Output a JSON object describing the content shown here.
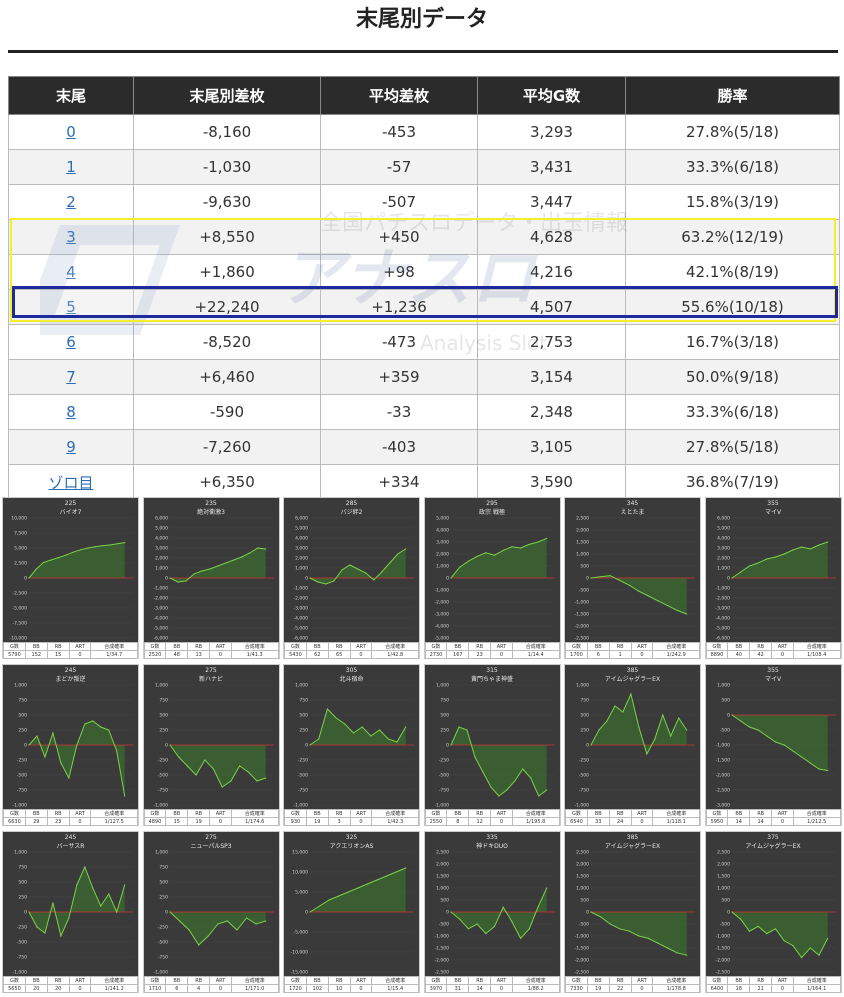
{
  "page": {
    "title": "末尾別データ"
  },
  "table": {
    "headers": [
      "末尾",
      "末尾別差枚",
      "平均差枚",
      "平均G数",
      "勝率"
    ],
    "rows": [
      {
        "tail": "0",
        "diff": "-8,160",
        "avg_diff": "-453",
        "avg_games": "3,293",
        "win_rate": "27.8%(5/18)"
      },
      {
        "tail": "1",
        "diff": "-1,030",
        "avg_diff": "-57",
        "avg_games": "3,431",
        "win_rate": "33.3%(6/18)"
      },
      {
        "tail": "2",
        "diff": "-9,630",
        "avg_diff": "-507",
        "avg_games": "3,447",
        "win_rate": "15.8%(3/19)"
      },
      {
        "tail": "3",
        "diff": "+8,550",
        "avg_diff": "+450",
        "avg_games": "4,628",
        "win_rate": "63.2%(12/19)"
      },
      {
        "tail": "4",
        "diff": "+1,860",
        "avg_diff": "+98",
        "avg_games": "4,216",
        "win_rate": "42.1%(8/19)"
      },
      {
        "tail": "5",
        "diff": "+22,240",
        "avg_diff": "+1,236",
        "avg_games": "4,507",
        "win_rate": "55.6%(10/18)"
      },
      {
        "tail": "6",
        "diff": "-8,520",
        "avg_diff": "-473",
        "avg_games": "2,753",
        "win_rate": "16.7%(3/18)"
      },
      {
        "tail": "7",
        "diff": "+6,460",
        "avg_diff": "+359",
        "avg_games": "3,154",
        "win_rate": "50.0%(9/18)"
      },
      {
        "tail": "8",
        "diff": "-590",
        "avg_diff": "-33",
        "avg_games": "2,348",
        "win_rate": "33.3%(6/18)"
      },
      {
        "tail": "9",
        "diff": "-7,260",
        "avg_diff": "-403",
        "avg_games": "3,105",
        "win_rate": "27.8%(5/18)"
      },
      {
        "tail": "ゾロ目",
        "diff": "+6,350",
        "avg_diff": "+334",
        "avg_games": "3,590",
        "win_rate": "36.8%(7/19)"
      }
    ]
  },
  "watermark": {
    "line1": "全国パチスロデータ・出玉情報",
    "brand": "アナスロ",
    "line2": "Analysis Slot"
  },
  "colors": {
    "highlight_yellow": "#f3ef2a",
    "highlight_blue": "#1d2a99",
    "header_bg": "#2b2b2b",
    "link": "#2c6db3",
    "panel_bg": "#3a3a3a",
    "line": "#7bd14a",
    "zero_line": "#d03030"
  },
  "panel_footer_labels": [
    "G数",
    "BB",
    "RB",
    "ART",
    "合成確率"
  ],
  "machines": [
    {
      "num": "225",
      "name": "バイオ7",
      "yticks": [
        "10,000",
        "7,500",
        "5,000",
        "2,500",
        "0",
        "-2,500",
        "-5,000",
        "-7,500",
        "-10,000"
      ],
      "ymin": -10000,
      "ymax": 10000,
      "series": [
        0,
        1500,
        2600,
        3000,
        3400,
        3800,
        4300,
        4700,
        5000,
        5200,
        5400,
        5500,
        5700,
        5900
      ],
      "stats": [
        "5790",
        "152",
        "15",
        "0",
        "1/34.7"
      ]
    },
    {
      "num": "235",
      "name": "絶対衝激3",
      "yticks": [
        "6,000",
        "5,000",
        "4,000",
        "3,000",
        "2,000",
        "1,000",
        "0",
        "-1,000",
        "-2,000",
        "-3,000",
        "-4,000",
        "-5,000",
        "-6,000"
      ],
      "ymin": -6000,
      "ymax": 6000,
      "series": [
        0,
        -400,
        -300,
        400,
        700,
        900,
        1200,
        1500,
        1800,
        2100,
        2500,
        3000,
        2900
      ],
      "stats": [
        "2520",
        "48",
        "13",
        "0",
        "1/41.3"
      ]
    },
    {
      "num": "285",
      "name": "バジ絆2",
      "yticks": [
        "6,000",
        "5,000",
        "4,000",
        "3,000",
        "2,000",
        "1,000",
        "0",
        "-1,000",
        "-2,000",
        "-3,000",
        "-4,000",
        "-5,000",
        "-6,000"
      ],
      "ymin": -6000,
      "ymax": 6000,
      "series": [
        0,
        -400,
        -600,
        -300,
        800,
        1300,
        900,
        500,
        -200,
        600,
        1500,
        2400,
        2900
      ],
      "stats": [
        "5430",
        "62",
        "65",
        "0",
        "1/42.8"
      ]
    },
    {
      "num": "295",
      "name": "政宗 戦極",
      "yticks": [
        "5,000",
        "4,000",
        "3,000",
        "2,000",
        "1,000",
        "0",
        "-1,000",
        "-2,000",
        "-3,000",
        "-4,000",
        "-5,000"
      ],
      "ymin": -5000,
      "ymax": 5000,
      "series": [
        0,
        900,
        1400,
        1800,
        2100,
        1900,
        2300,
        2600,
        2500,
        2800,
        3000,
        3300
      ],
      "stats": [
        "2730",
        "167",
        "23",
        "0",
        "1/14.4"
      ]
    },
    {
      "num": "345",
      "name": "えとたま",
      "yticks": [
        "2,500",
        "2,000",
        "1,500",
        "1,000",
        "500",
        "0",
        "-500",
        "-1,000",
        "-1,500",
        "-2,000",
        "-2,500"
      ],
      "ymin": -2500,
      "ymax": 2500,
      "series": [
        0,
        50,
        100,
        -100,
        -300,
        -550,
        -750,
        -950,
        -1150,
        -1350,
        -1500
      ],
      "stats": [
        "1700",
        "6",
        "1",
        "0",
        "1/242.9"
      ]
    },
    {
      "num": "355",
      "name": "マイV",
      "yticks": [
        "6,000",
        "5,000",
        "4,000",
        "3,000",
        "2,000",
        "1,000",
        "0",
        "-1,000",
        "-2,000",
        "-3,000",
        "-4,000",
        "-5,000",
        "-6,000"
      ],
      "ymin": -6000,
      "ymax": 6000,
      "series": [
        0,
        600,
        1200,
        1500,
        1900,
        2100,
        2400,
        2800,
        3100,
        2900,
        3300,
        3600
      ],
      "stats": [
        "8890",
        "40",
        "42",
        "0",
        "1/108.4"
      ]
    },
    {
      "num": "245",
      "name": "まどか叛逆",
      "yticks": [
        "1,000",
        "750",
        "500",
        "250",
        "0",
        "-250",
        "-500",
        "-750",
        "-1,000"
      ],
      "ymin": -1000,
      "ymax": 1000,
      "series": [
        0,
        150,
        -200,
        200,
        -300,
        -550,
        0,
        350,
        400,
        300,
        250,
        -100,
        -850
      ],
      "stats": [
        "6630",
        "29",
        "23",
        "0",
        "1/127.5"
      ]
    },
    {
      "num": "275",
      "name": "新ハナビ",
      "yticks": [
        "1,000",
        "750",
        "500",
        "250",
        "0",
        "-250",
        "-500",
        "-750",
        "-1,000"
      ],
      "ymin": -1000,
      "ymax": 1000,
      "series": [
        0,
        -200,
        -350,
        -500,
        -250,
        -400,
        -700,
        -600,
        -350,
        -450,
        -600,
        -550
      ],
      "stats": [
        "4890",
        "15",
        "19",
        "0",
        "1/174.6"
      ]
    },
    {
      "num": "305",
      "name": "北斗宿命",
      "yticks": [
        "1,000",
        "750",
        "500",
        "250",
        "0",
        "-250",
        "-500",
        "-750",
        "-1,000"
      ],
      "ymin": -1000,
      "ymax": 1000,
      "series": [
        0,
        100,
        600,
        450,
        350,
        200,
        300,
        150,
        250,
        100,
        50,
        300
      ],
      "stats": [
        "930",
        "19",
        "3",
        "0",
        "1/42.3"
      ]
    },
    {
      "num": "315",
      "name": "黄門ちゃま神盛",
      "yticks": [
        "1,000",
        "750",
        "500",
        "250",
        "0",
        "-250",
        "-500",
        "-750",
        "-1,000"
      ],
      "ymin": -1000,
      "ymax": 1000,
      "series": [
        0,
        300,
        250,
        -200,
        -450,
        -700,
        -850,
        -750,
        -600,
        -400,
        -550,
        -850,
        -750
      ],
      "stats": [
        "2550",
        "8",
        "12",
        "0",
        "1/195.8"
      ]
    },
    {
      "num": "385",
      "name": "アイムジャグラーEX",
      "yticks": [
        "1,000",
        "750",
        "500",
        "250",
        "0",
        "-250",
        "-500",
        "-750",
        "-1,000"
      ],
      "ymin": -1000,
      "ymax": 1000,
      "series": [
        0,
        250,
        400,
        650,
        550,
        850,
        300,
        -150,
        100,
        500,
        150,
        450,
        250
      ],
      "stats": [
        "6540",
        "33",
        "24",
        "0",
        "1/118.1"
      ]
    },
    {
      "num": "355",
      "name": "マイV",
      "yticks": [
        "1,000",
        "500",
        "0",
        "-500",
        "-1,000",
        "-1,500",
        "-2,000",
        "-2,500",
        "-3,000"
      ],
      "ymin": -3000,
      "ymax": 1000,
      "series": [
        0,
        -200,
        -400,
        -500,
        -700,
        -900,
        -1000,
        -1200,
        -1400,
        -1600,
        -1800,
        -1850
      ],
      "stats": [
        "5950",
        "14",
        "14",
        "0",
        "1/212.5"
      ]
    },
    {
      "num": "245",
      "name": "バーサスR",
      "yticks": [
        "1,000",
        "750",
        "500",
        "250",
        "0",
        "-250",
        "-500",
        "-750",
        "-1,000"
      ],
      "ymin": -1000,
      "ymax": 1000,
      "series": [
        0,
        -250,
        -350,
        150,
        -400,
        -100,
        450,
        750,
        400,
        100,
        300,
        0,
        450
      ],
      "stats": [
        "5650",
        "20",
        "20",
        "0",
        "1/141.2"
      ]
    },
    {
      "num": "275",
      "name": "ニューパルSP3",
      "yticks": [
        "1,000",
        "750",
        "500",
        "250",
        "0",
        "-250",
        "-500",
        "-750",
        "-1,000"
      ],
      "ymin": -1000,
      "ymax": 1000,
      "series": [
        0,
        -150,
        -300,
        -550,
        -400,
        -200,
        -150,
        -300,
        -100,
        -200,
        -150
      ],
      "stats": [
        "1710",
        "6",
        "4",
        "0",
        "1/171.0"
      ]
    },
    {
      "num": "325",
      "name": "アクエリオンAS",
      "yticks": [
        "15,000",
        "10,000",
        "5,000",
        "0",
        "-5,000",
        "-10,000",
        "-15,000"
      ],
      "ymin": -15000,
      "ymax": 15000,
      "series": [
        0,
        1500,
        3000,
        4000,
        5000,
        6000,
        7000,
        8000,
        9000,
        10000,
        11000
      ],
      "stats": [
        "1720",
        "102",
        "10",
        "0",
        "1/15.4"
      ]
    },
    {
      "num": "335",
      "name": "神ドキDUO",
      "yticks": [
        "2,500",
        "2,000",
        "1,500",
        "1,000",
        "500",
        "0",
        "-500",
        "-1,000",
        "-1,500",
        "-2,000",
        "-2,500"
      ],
      "ymin": -2500,
      "ymax": 2500,
      "series": [
        0,
        -300,
        -700,
        -500,
        -900,
        -600,
        200,
        -400,
        -1100,
        -700,
        200,
        1000
      ],
      "stats": [
        "3970",
        "31",
        "14",
        "0",
        "1/88.2"
      ]
    },
    {
      "num": "385",
      "name": "アイムジャグラーEX",
      "yticks": [
        "2,500",
        "2,000",
        "1,500",
        "1,000",
        "500",
        "0",
        "-500",
        "-1,000",
        "-1,500",
        "-2,000",
        "-2,500"
      ],
      "ymin": -2500,
      "ymax": 2500,
      "series": [
        0,
        -200,
        -500,
        -700,
        -800,
        -1000,
        -1100,
        -1300,
        -1500,
        -1700,
        -1800
      ],
      "stats": [
        "7330",
        "19",
        "22",
        "0",
        "1/178.8"
      ]
    },
    {
      "num": "375",
      "name": "アイムジャグラーEX",
      "yticks": [
        "2,500",
        "2,000",
        "1,500",
        "1,000",
        "500",
        "0",
        "-500",
        "-1,000",
        "-1,500",
        "-2,000",
        "-2,500"
      ],
      "ymin": -2500,
      "ymax": 2500,
      "series": [
        0,
        -300,
        -800,
        -600,
        -900,
        -700,
        -1200,
        -1400,
        -1900,
        -1500,
        -1800,
        -1100
      ],
      "stats": [
        "6400",
        "18",
        "21",
        "0",
        "1/164.1"
      ]
    }
  ]
}
